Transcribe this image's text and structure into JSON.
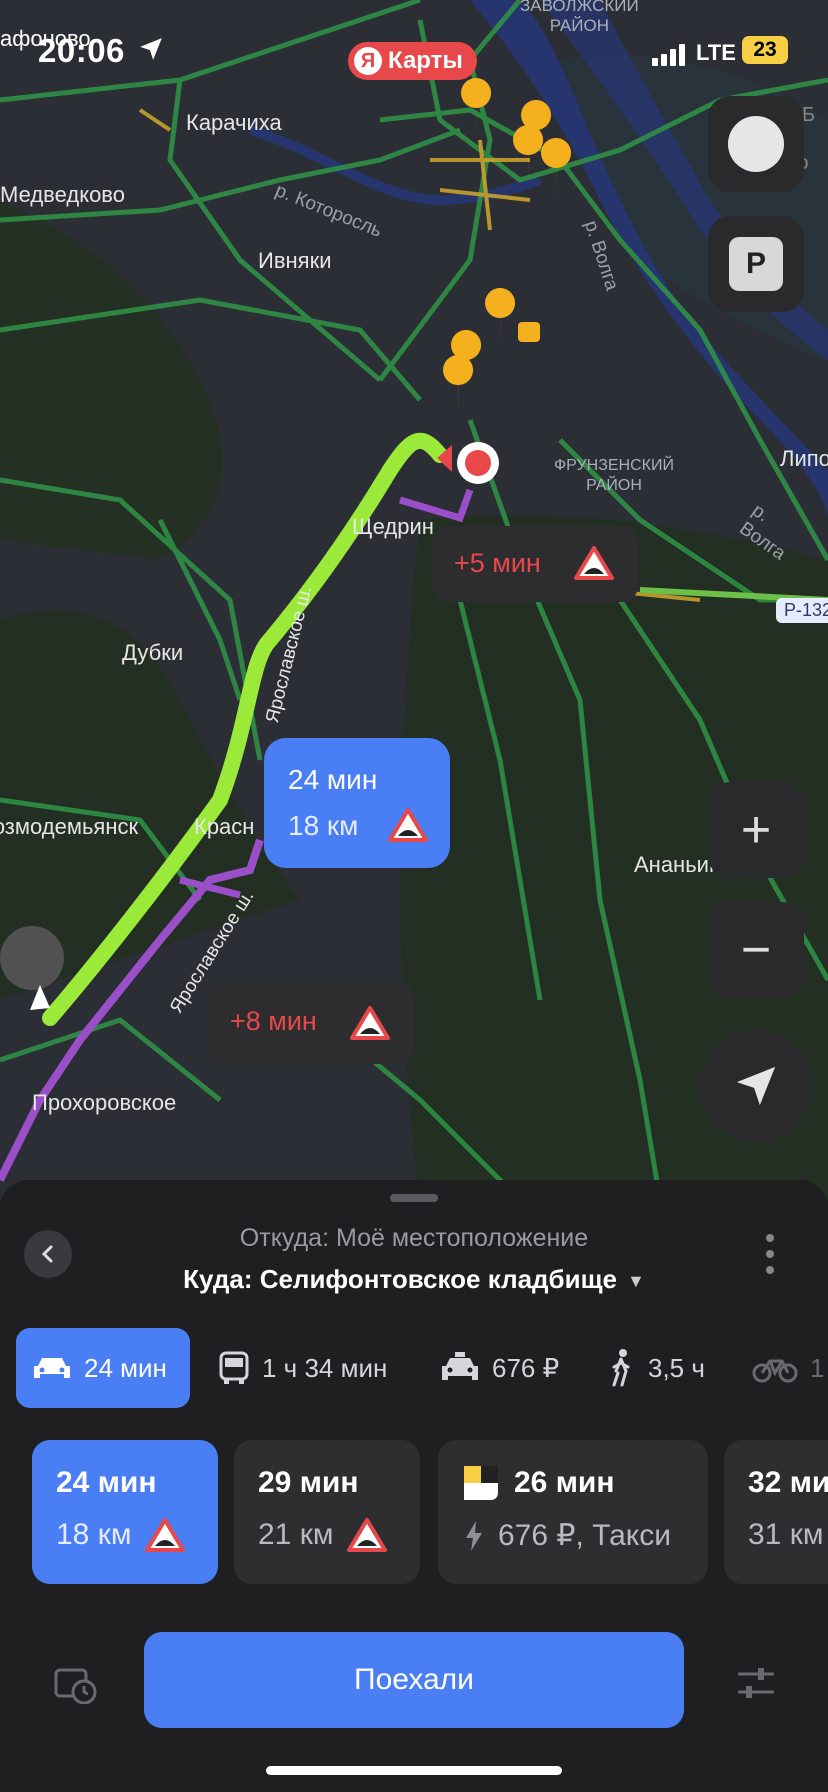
{
  "status": {
    "time": "20:06",
    "carrier": "LTE",
    "battery": "23",
    "app_badge": "Карты",
    "app_badge_logo": "Я",
    "corner_text": "афоново"
  },
  "map": {
    "labels": {
      "zavolzhsky": "ЗАВОЛЖСКИЙ\nРАЙОН",
      "karachikha": "Карачиха",
      "medvedkovo": "Медведково",
      "ivnyaki": "Ивняки",
      "kotorosl": "р. Которосль",
      "volga": "р. Волга",
      "volga2": "р. Волга",
      "frunzensky": "ФРУНЗЕНСКИЙ\nРАЙОН",
      "shchedrino": "Щедрин",
      "dubki": "Дубки",
      "kozmodemyansk": "Козмодемьянск",
      "krasnoe": "Красн",
      "ananyino": "Ананьино",
      "prokhorovskoe": "Прохоровское",
      "yaroslavskoe1": "Ярославское ш.",
      "yaroslavskoe2": "Ярославское ш.",
      "lipo": "Липо",
      "krasny": "Красный Б",
      "elokhovo": "Елохово",
      "r132": "Р-132"
    },
    "route_bubble": {
      "time": "24 мин",
      "distance": "18 км"
    },
    "alt_bubble_1": {
      "text": "+5 мин"
    },
    "alt_bubble_2": {
      "text": "+8 мин"
    },
    "buttons": {
      "layers": "layers-icon",
      "parking": "P",
      "zoom_in": "+",
      "zoom_out": "−",
      "locate": "navigation-arrow-icon"
    }
  },
  "sheet": {
    "from": "Откуда: Моё местоположение",
    "to": "Куда: Селифонтовское кладбище",
    "modes": [
      {
        "icon": "car-icon",
        "label": "24 мин"
      },
      {
        "icon": "bus-icon",
        "label": "1 ч 34 мин"
      },
      {
        "icon": "taxi-icon",
        "label": "676 ₽"
      },
      {
        "icon": "walk-icon",
        "label": "3,5 ч"
      },
      {
        "icon": "bike-icon",
        "label": "1"
      }
    ],
    "routes": [
      {
        "time": "24 мин",
        "distance": "18 км"
      },
      {
        "time": "29 мин",
        "distance": "21 км"
      },
      {
        "time": "26 мин",
        "distance": "676 ₽, Такси"
      },
      {
        "time": "32 ми",
        "distance": "31 км"
      }
    ],
    "go_button": "Поехали"
  },
  "colors": {
    "accent": "#4a7ef5",
    "route": "#9bea3a",
    "alt_route": "#9a4fc9",
    "warning": "#e8484a",
    "pin": "#f5b01d"
  }
}
